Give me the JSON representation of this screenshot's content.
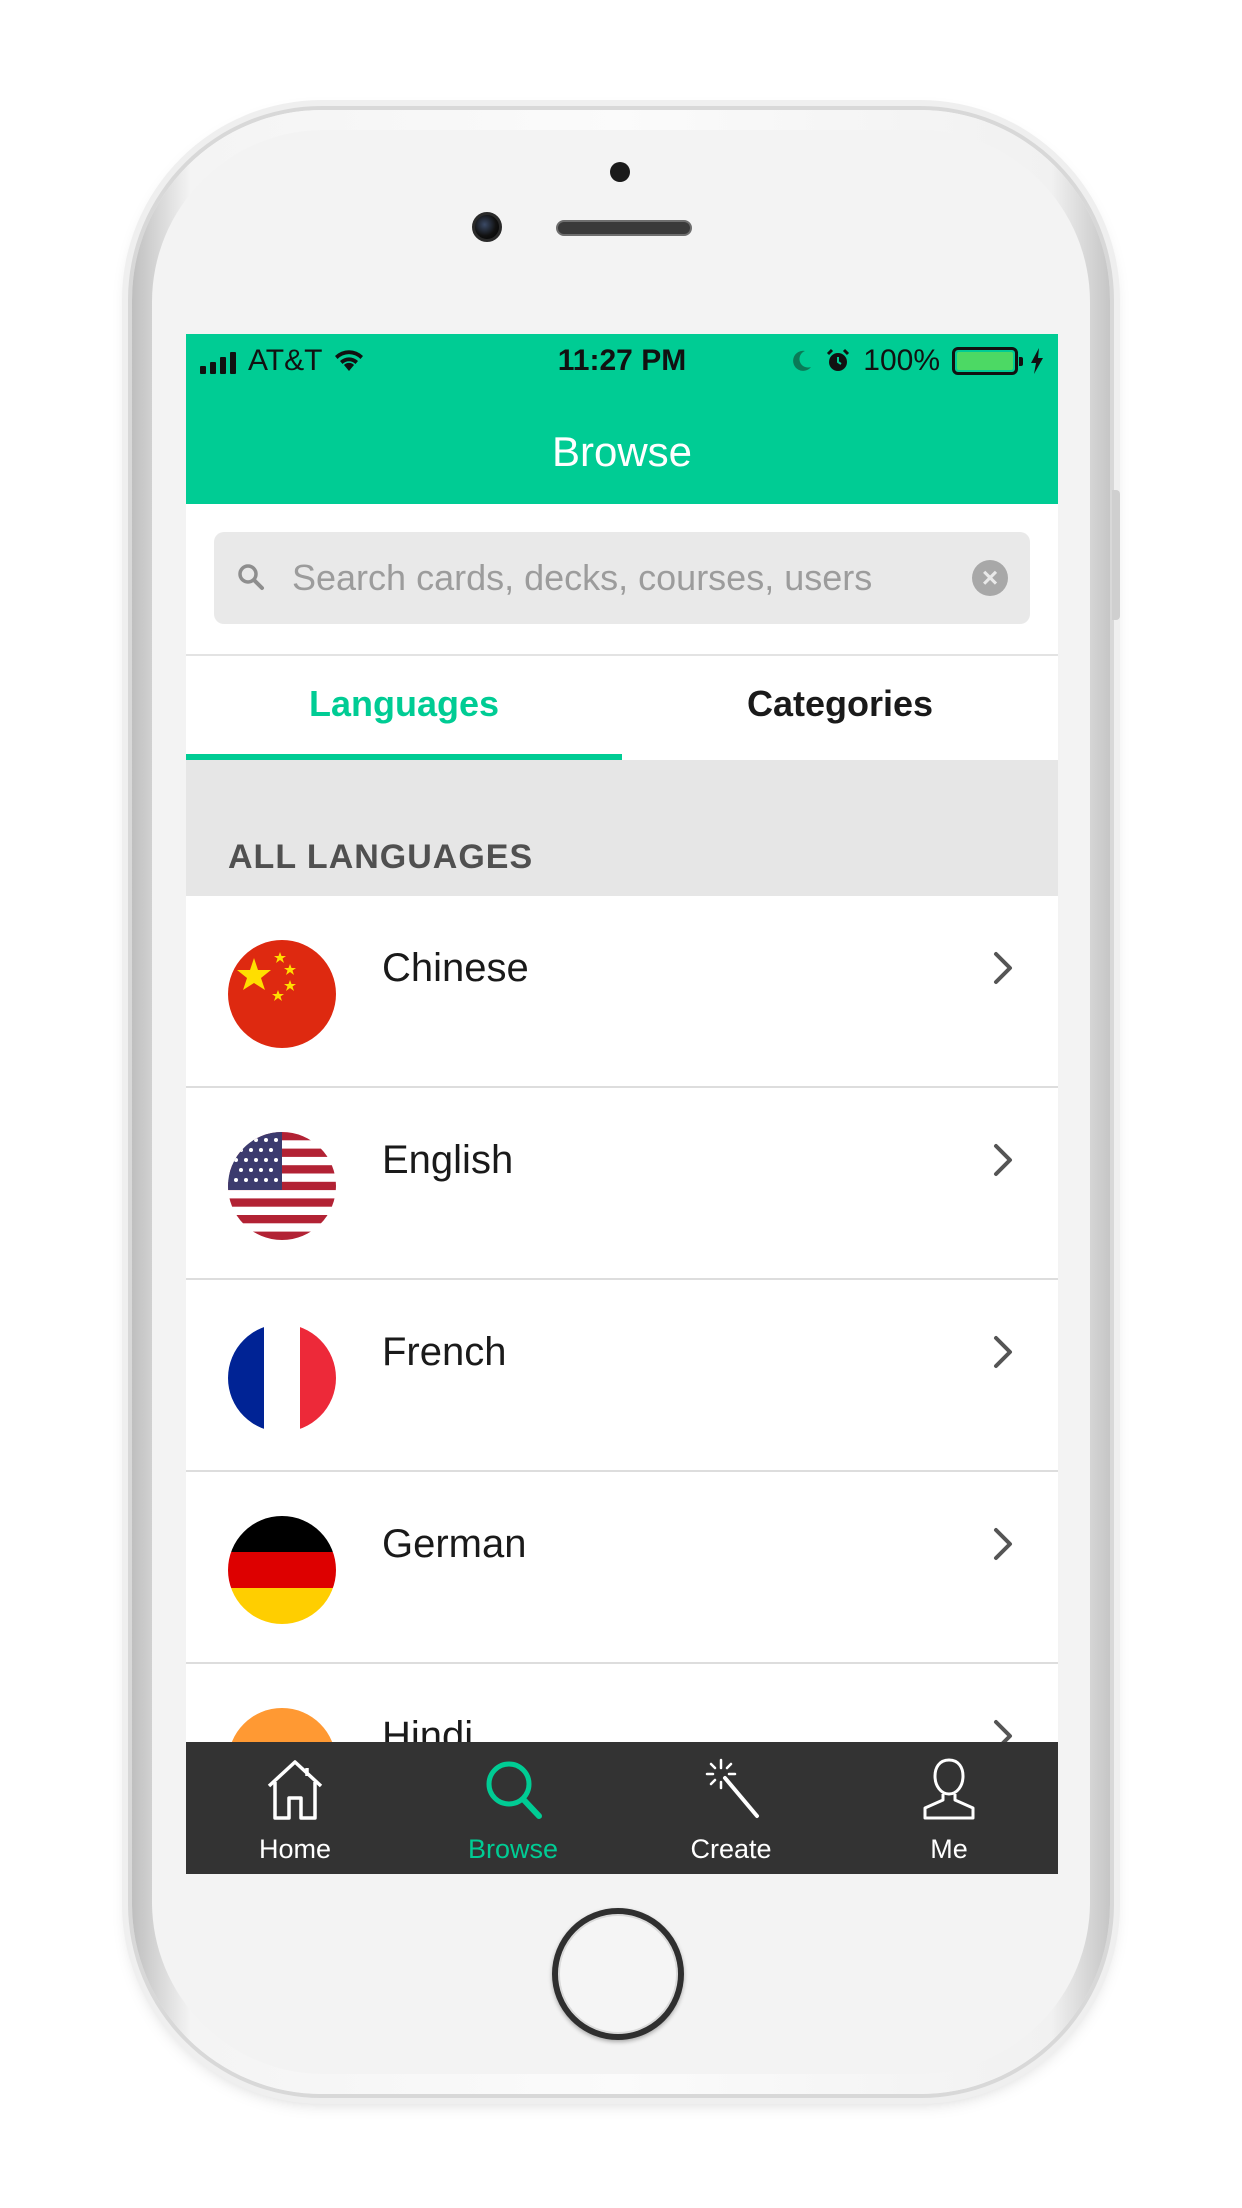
{
  "status_bar": {
    "carrier": "AT&T",
    "time": "11:27 PM",
    "battery": "100%"
  },
  "nav": {
    "title": "Browse"
  },
  "search": {
    "placeholder": "Search cards, decks, courses, users"
  },
  "tabs": [
    {
      "label": "Languages",
      "active": true
    },
    {
      "label": "Categories",
      "active": false
    }
  ],
  "section": {
    "title": "ALL LANGUAGES"
  },
  "languages": [
    {
      "name": "Chinese",
      "flag": "china-flag-icon"
    },
    {
      "name": "English",
      "flag": "usa-flag-icon"
    },
    {
      "name": "French",
      "flag": "france-flag-icon"
    },
    {
      "name": "German",
      "flag": "germany-flag-icon"
    },
    {
      "name": "Hindi",
      "flag": "india-flag-icon"
    }
  ],
  "tab_bar": [
    {
      "label": "Home",
      "icon": "home-icon"
    },
    {
      "label": "Browse",
      "icon": "search-icon",
      "active": true
    },
    {
      "label": "Create",
      "icon": "magic-wand-icon"
    },
    {
      "label": "Me",
      "icon": "user-icon"
    }
  ],
  "colors": {
    "accent": "#00cc94",
    "tab_bar_bg": "#333333"
  }
}
